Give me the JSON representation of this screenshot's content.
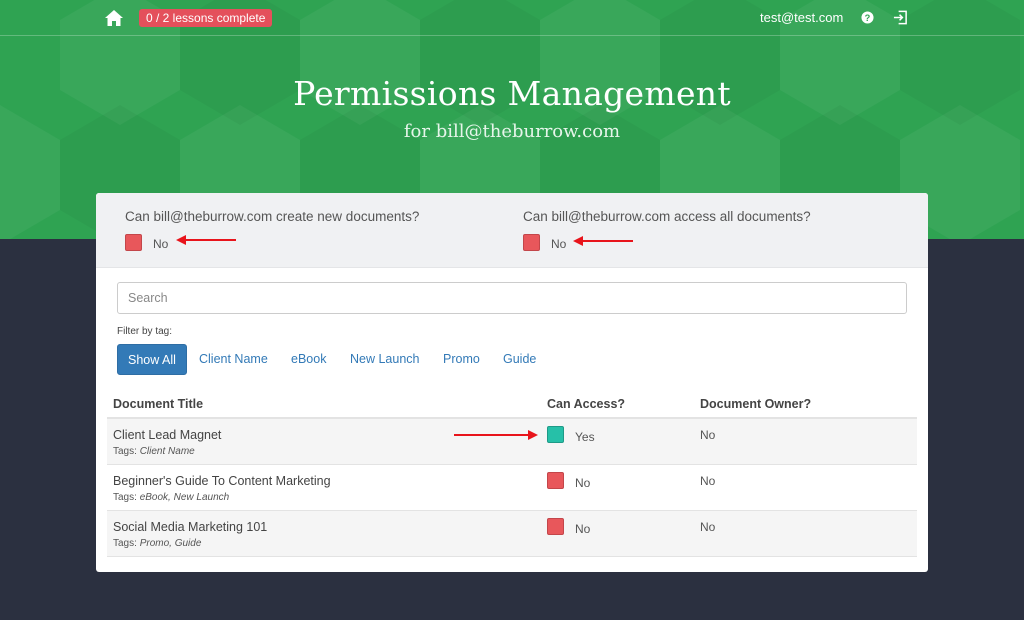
{
  "topbar": {
    "lessons_badge": "0 / 2 lessons complete",
    "user_email": "test@test.com"
  },
  "header": {
    "title": "Permissions Management",
    "subtitle": "for bill@theburrow.com"
  },
  "permissions": {
    "create_docs": {
      "question": "Can bill@theburrow.com create new documents?",
      "value": "No"
    },
    "access_all": {
      "question": "Can bill@theburrow.com access all documents?",
      "value": "No"
    }
  },
  "search": {
    "placeholder": "Search"
  },
  "filter": {
    "label": "Filter by tag:",
    "tags": [
      "Show All",
      "Client Name",
      "eBook",
      "New Launch",
      "Promo",
      "Guide"
    ]
  },
  "table": {
    "headers": [
      "Document Title",
      "Can Access?",
      "Document Owner?"
    ],
    "tags_prefix": "Tags:",
    "rows": [
      {
        "title": "Client Lead Magnet",
        "tags": "Client Name",
        "access": "Yes",
        "owner": "No"
      },
      {
        "title": "Beginner's Guide To Content Marketing",
        "tags": "eBook, New Launch",
        "access": "No",
        "owner": "No"
      },
      {
        "title": "Social Media Marketing 101",
        "tags": "Promo, Guide",
        "access": "No",
        "owner": "No"
      }
    ]
  },
  "colors": {
    "hero_green": "#2fa352",
    "badge_red": "#e4505b",
    "no_red": "#e8575b",
    "yes_teal": "#26c0a8",
    "link_blue": "#337ab7",
    "page_dark": "#2b3040"
  },
  "icons": [
    "home-icon",
    "help-icon",
    "logout-icon"
  ]
}
